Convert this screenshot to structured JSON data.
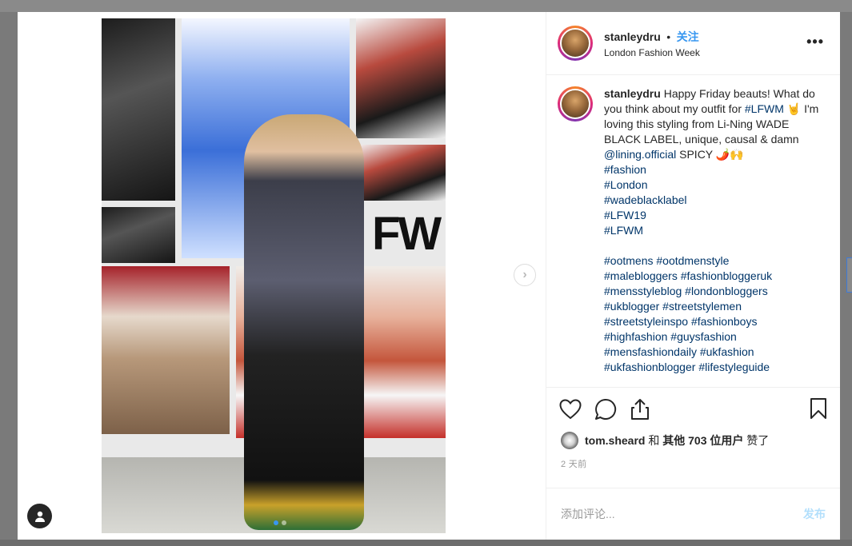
{
  "post": {
    "username": "stanleydru",
    "separator": "•",
    "follow_label": "关注",
    "location": "London Fashion Week",
    "more_label": "•••"
  },
  "media": {
    "poster_text": "FW",
    "next_label": "›",
    "dots": 2
  },
  "caption": {
    "username": "stanleydru",
    "text_before_tag": "Happy Friday beauts! What do you think about my outfit for",
    "tag_lfwm": "#LFWM",
    "text_after_tag": "🤘 I'm loving this styling from Li-Ning WADE BLACK LABEL, unique, causal & damn",
    "mention": "@lining.official",
    "text_end": "SPICY 🌶️🙌",
    "hashtags_block1": [
      "#fashion",
      "#London",
      "#wadeblacklabel",
      "#LFW19",
      "#LFWM"
    ],
    "hashtags_block2": [
      "#ootmens",
      "#ootdmenstyle",
      "#malebloggers",
      "#fashionbloggeruk",
      "#mensstyleblog",
      "#londonbloggers",
      "#ukblogger",
      "#streetstylemen",
      "#streetstyleinspo",
      "#fashionboys",
      "#highfashion",
      "#guysfashion",
      "#mensfashiondaily",
      "#ukfashion",
      "#ukfashionblogger",
      "#lifestyleguide"
    ]
  },
  "actions": {
    "like": "heart-icon",
    "comment": "comment-icon",
    "share": "share-icon",
    "save": "bookmark-icon"
  },
  "likes": {
    "liker": "tom.sheard",
    "and": "和",
    "others": "其他 703 位用户",
    "suffix": "赞了"
  },
  "timestamp": "2 天前",
  "comment": {
    "placeholder": "添加评论...",
    "post_label": "发布"
  },
  "colors": {
    "link": "#003569",
    "follow": "#3897f0",
    "post_disabled": "#b2dffc"
  }
}
